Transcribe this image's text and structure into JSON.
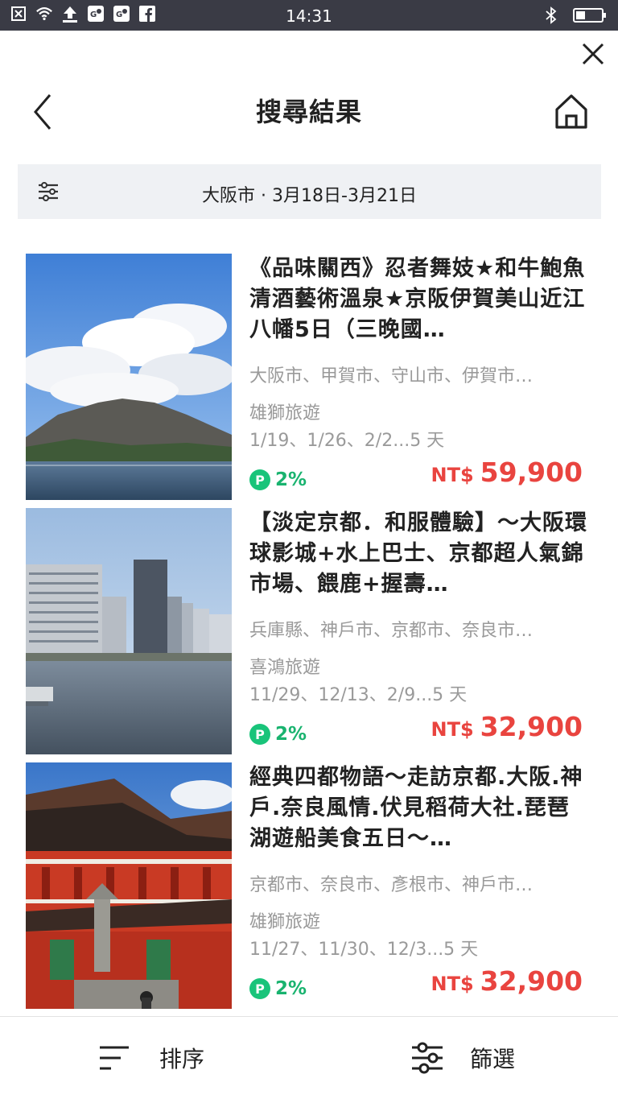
{
  "status_bar": {
    "time": "14:31",
    "left_icons": [
      "notification-x-icon",
      "wifi-icon",
      "upload-icon",
      "maps-icon",
      "maps-icon",
      "facebook-icon"
    ],
    "right_icons": [
      "bluetooth-icon",
      "battery-icon"
    ]
  },
  "header": {
    "title": "搜尋結果"
  },
  "search_summary": {
    "text": "大阪市 · 3月18日-3月21日"
  },
  "results": [
    {
      "title": "《品味關西》忍者舞妓★和牛鮑魚清酒藝術溫泉★京阪伊賀美山近江八幡5日（三晚國…",
      "locations": "大阪市、甲賀市、守山市、伊賀市…",
      "agency": "雄獅旅遊",
      "dates": "1/19、1/26、2/2...5 天",
      "points": "2%",
      "price_currency": "NT$",
      "price": "59,900",
      "image": "volcano-lake"
    },
    {
      "title": "【淡定京都．和服體驗】～大阪環球影城+水上巴士、京都超人氣錦市場、餵鹿+握壽…",
      "locations": "兵庫縣、神戶市、京都市、奈良市…",
      "agency": "喜鴻旅遊",
      "dates": "11/29、12/13、2/9...5 天",
      "points": "2%",
      "price_currency": "NT$",
      "price": "32,900",
      "image": "city-river"
    },
    {
      "title": "經典四都物語～走訪京都.大阪.神戶.奈良風情.伏見稻荷大社.琵琶湖遊船美食五日～…",
      "locations": "京都市、奈良市、彥根市、神戶市…",
      "agency": "雄獅旅遊",
      "dates": "11/27、11/30、12/3...5 天",
      "points": "2%",
      "price_currency": "NT$",
      "price": "32,900",
      "image": "red-shrine"
    }
  ],
  "bottom_bar": {
    "sort_label": "排序",
    "filter_label": "篩選"
  },
  "colors": {
    "status_bar_bg": "#3a3b45",
    "price": "#e9443f",
    "points_green": "#19c47a",
    "summary_bg": "#eff1f4"
  }
}
